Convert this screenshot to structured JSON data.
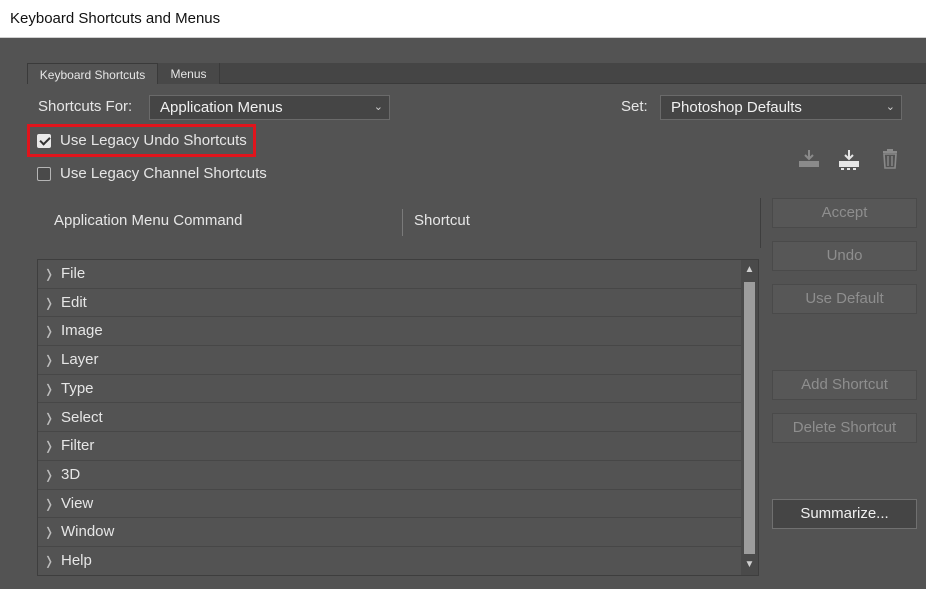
{
  "window": {
    "title": "Keyboard Shortcuts and Menus"
  },
  "tabs": [
    {
      "label": "Keyboard Shortcuts",
      "active": true
    },
    {
      "label": "Menus",
      "active": false
    }
  ],
  "shortcuts_for": {
    "label": "Shortcuts For:",
    "value": "Application Menus"
  },
  "set": {
    "label": "Set:",
    "value": "Photoshop Defaults"
  },
  "checkboxes": [
    {
      "label": "Use Legacy Undo Shortcuts",
      "checked": true
    },
    {
      "label": "Use Legacy Channel Shortcuts",
      "checked": false
    }
  ],
  "toolbar_icons": [
    "save-set-icon",
    "save-set-as-icon",
    "delete-set-icon"
  ],
  "table": {
    "col_command": "Application Menu Command",
    "col_shortcut": "Shortcut",
    "rows": [
      "File",
      "Edit",
      "Image",
      "Layer",
      "Type",
      "Select",
      "Filter",
      "3D",
      "View",
      "Window",
      "Help"
    ]
  },
  "buttons": {
    "accept": "Accept",
    "undo": "Undo",
    "use_default": "Use Default",
    "add_shortcut": "Add Shortcut",
    "delete_shortcut": "Delete Shortcut",
    "summarize": "Summarize..."
  },
  "colors": {
    "dialog_bg": "#535353",
    "highlight": "#e0141c"
  }
}
